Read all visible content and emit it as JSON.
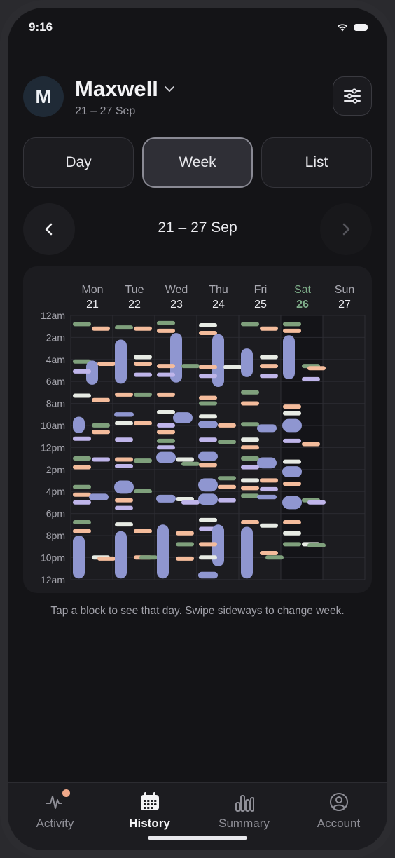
{
  "status": {
    "time": "9:16",
    "wifi_icon": "wifi-icon",
    "battery_icon": "battery-icon"
  },
  "header": {
    "avatar_initial": "M",
    "name": "Maxwell",
    "subtitle": "21 – 27 Sep",
    "dropdown_icon": "chevron-down-icon",
    "filter_icon": "sliders-icon"
  },
  "view_tabs": [
    {
      "label": "Day",
      "active": false
    },
    {
      "label": "Week",
      "active": true
    },
    {
      "label": "List",
      "active": false
    }
  ],
  "week_nav": {
    "title": "21 – 27 Sep",
    "prev_icon": "chevron-left-icon",
    "next_icon": "chevron-right-icon"
  },
  "chart_data": {
    "type": "heatmap",
    "days": [
      {
        "name": "Mon",
        "date": "21",
        "today": false
      },
      {
        "name": "Tue",
        "date": "22",
        "today": false
      },
      {
        "name": "Wed",
        "date": "23",
        "today": false
      },
      {
        "name": "Thu",
        "date": "24",
        "today": false
      },
      {
        "name": "Fri",
        "date": "25",
        "today": false
      },
      {
        "name": "Sat",
        "date": "26",
        "today": true
      },
      {
        "name": "Sun",
        "date": "27",
        "today": false
      }
    ],
    "hour_labels": [
      "12am",
      "2am",
      "4am",
      "6am",
      "8am",
      "10am",
      "12pm",
      "2pm",
      "4pm",
      "6pm",
      "8pm",
      "10pm",
      "12am"
    ],
    "colors": {
      "sleep": "#8f96d0",
      "feed": "#f4bc9c",
      "nappy": "#7fa07c",
      "play": "#e7ebe4",
      "other": "#bfb5ea",
      "today": "#7fae8a"
    },
    "blocks": [
      {
        "day": 0,
        "lane": 0,
        "start": 0.6,
        "end": 1.0,
        "kind": "nappy"
      },
      {
        "day": 0,
        "lane": 1,
        "start": 1.0,
        "end": 1.4,
        "kind": "feed"
      },
      {
        "day": 0,
        "lane": 0,
        "start": 4.0,
        "end": 4.4,
        "kind": "nappy"
      },
      {
        "day": 0,
        "lane": 1,
        "start": 4.1,
        "end": 6.3,
        "kind": "sleep"
      },
      {
        "day": 0,
        "lane": 2,
        "start": 4.2,
        "end": 4.6,
        "kind": "feed"
      },
      {
        "day": 0,
        "lane": 0,
        "start": 4.9,
        "end": 5.3,
        "kind": "other"
      },
      {
        "day": 0,
        "lane": 0,
        "start": 7.1,
        "end": 7.5,
        "kind": "play"
      },
      {
        "day": 0,
        "lane": 1,
        "start": 7.5,
        "end": 7.9,
        "kind": "feed"
      },
      {
        "day": 0,
        "lane": 0,
        "start": 9.2,
        "end": 10.7,
        "kind": "sleep"
      },
      {
        "day": 0,
        "lane": 1,
        "start": 9.8,
        "end": 10.2,
        "kind": "nappy"
      },
      {
        "day": 0,
        "lane": 1,
        "start": 10.4,
        "end": 10.8,
        "kind": "feed"
      },
      {
        "day": 0,
        "lane": 0,
        "start": 11.0,
        "end": 11.4,
        "kind": "other"
      },
      {
        "day": 0,
        "lane": 0,
        "start": 12.8,
        "end": 13.2,
        "kind": "nappy"
      },
      {
        "day": 0,
        "lane": 1,
        "start": 12.9,
        "end": 13.5,
        "kind": "other"
      },
      {
        "day": 0,
        "lane": 0,
        "start": 13.6,
        "end": 14.0,
        "kind": "feed"
      },
      {
        "day": 0,
        "lane": 0,
        "start": 15.4,
        "end": 15.8,
        "kind": "nappy"
      },
      {
        "day": 0,
        "lane": 0,
        "start": 16.1,
        "end": 16.5,
        "kind": "feed"
      },
      {
        "day": 0,
        "lane": 1,
        "start": 16.2,
        "end": 16.8,
        "kind": "sleep"
      },
      {
        "day": 0,
        "lane": 0,
        "start": 16.8,
        "end": 17.2,
        "kind": "other"
      },
      {
        "day": 0,
        "lane": 0,
        "start": 18.6,
        "end": 19.0,
        "kind": "nappy"
      },
      {
        "day": 0,
        "lane": 0,
        "start": 19.4,
        "end": 19.8,
        "kind": "feed"
      },
      {
        "day": 0,
        "lane": 0,
        "start": 20.0,
        "end": 23.9,
        "kind": "sleep"
      },
      {
        "day": 0,
        "lane": 1,
        "start": 21.8,
        "end": 22.2,
        "kind": "play"
      },
      {
        "day": 0,
        "lane": 2,
        "start": 21.9,
        "end": 22.3,
        "kind": "feed"
      },
      {
        "day": 1,
        "lane": 0,
        "start": 0.9,
        "end": 1.3,
        "kind": "nappy"
      },
      {
        "day": 1,
        "lane": 1,
        "start": 1.0,
        "end": 1.4,
        "kind": "feed"
      },
      {
        "day": 1,
        "lane": 0,
        "start": 2.2,
        "end": 6.2,
        "kind": "sleep"
      },
      {
        "day": 1,
        "lane": 1,
        "start": 3.6,
        "end": 4.0,
        "kind": "play"
      },
      {
        "day": 1,
        "lane": 1,
        "start": 4.2,
        "end": 4.6,
        "kind": "feed"
      },
      {
        "day": 1,
        "lane": 1,
        "start": 5.2,
        "end": 5.6,
        "kind": "other"
      },
      {
        "day": 1,
        "lane": 0,
        "start": 7.0,
        "end": 7.4,
        "kind": "feed"
      },
      {
        "day": 1,
        "lane": 1,
        "start": 7.0,
        "end": 7.4,
        "kind": "nappy"
      },
      {
        "day": 1,
        "lane": 0,
        "start": 8.8,
        "end": 9.2,
        "kind": "sleep"
      },
      {
        "day": 1,
        "lane": 0,
        "start": 9.6,
        "end": 10.0,
        "kind": "play"
      },
      {
        "day": 1,
        "lane": 1,
        "start": 9.6,
        "end": 10.0,
        "kind": "feed"
      },
      {
        "day": 1,
        "lane": 0,
        "start": 11.1,
        "end": 11.5,
        "kind": "other"
      },
      {
        "day": 1,
        "lane": 0,
        "start": 12.9,
        "end": 13.3,
        "kind": "feed"
      },
      {
        "day": 1,
        "lane": 1,
        "start": 13.0,
        "end": 13.4,
        "kind": "nappy"
      },
      {
        "day": 1,
        "lane": 0,
        "start": 13.5,
        "end": 13.9,
        "kind": "other"
      },
      {
        "day": 1,
        "lane": 0,
        "start": 15.0,
        "end": 16.2,
        "kind": "sleep"
      },
      {
        "day": 1,
        "lane": 1,
        "start": 15.8,
        "end": 16.2,
        "kind": "nappy"
      },
      {
        "day": 1,
        "lane": 0,
        "start": 16.6,
        "end": 17.0,
        "kind": "feed"
      },
      {
        "day": 1,
        "lane": 0,
        "start": 17.3,
        "end": 17.7,
        "kind": "other"
      },
      {
        "day": 1,
        "lane": 0,
        "start": 18.8,
        "end": 19.2,
        "kind": "play"
      },
      {
        "day": 1,
        "lane": 1,
        "start": 19.4,
        "end": 19.8,
        "kind": "feed"
      },
      {
        "day": 1,
        "lane": 0,
        "start": 19.6,
        "end": 23.9,
        "kind": "sleep"
      },
      {
        "day": 1,
        "lane": 1,
        "start": 21.8,
        "end": 22.2,
        "kind": "feed"
      },
      {
        "day": 1,
        "lane": 2,
        "start": 21.8,
        "end": 22.2,
        "kind": "nappy"
      },
      {
        "day": 2,
        "lane": 0,
        "start": 0.5,
        "end": 0.9,
        "kind": "nappy"
      },
      {
        "day": 2,
        "lane": 0,
        "start": 1.2,
        "end": 1.6,
        "kind": "feed"
      },
      {
        "day": 2,
        "lane": 1,
        "start": 1.6,
        "end": 6.1,
        "kind": "sleep"
      },
      {
        "day": 2,
        "lane": 0,
        "start": 4.4,
        "end": 4.8,
        "kind": "feed"
      },
      {
        "day": 2,
        "lane": 2,
        "start": 4.4,
        "end": 4.8,
        "kind": "nappy"
      },
      {
        "day": 2,
        "lane": 0,
        "start": 5.2,
        "end": 5.6,
        "kind": "other"
      },
      {
        "day": 2,
        "lane": 0,
        "start": 7.0,
        "end": 7.4,
        "kind": "feed"
      },
      {
        "day": 2,
        "lane": 0,
        "start": 8.6,
        "end": 9.0,
        "kind": "play"
      },
      {
        "day": 2,
        "lane": 1,
        "start": 8.8,
        "end": 9.8,
        "kind": "sleep"
      },
      {
        "day": 2,
        "lane": 0,
        "start": 9.8,
        "end": 10.2,
        "kind": "other"
      },
      {
        "day": 2,
        "lane": 0,
        "start": 10.4,
        "end": 10.8,
        "kind": "feed"
      },
      {
        "day": 2,
        "lane": 0,
        "start": 11.2,
        "end": 11.6,
        "kind": "nappy"
      },
      {
        "day": 2,
        "lane": 0,
        "start": 11.8,
        "end": 12.2,
        "kind": "other"
      },
      {
        "day": 2,
        "lane": 0,
        "start": 12.4,
        "end": 13.4,
        "kind": "sleep"
      },
      {
        "day": 2,
        "lane": 1,
        "start": 12.9,
        "end": 13.3,
        "kind": "play"
      },
      {
        "day": 2,
        "lane": 2,
        "start": 13.3,
        "end": 13.7,
        "kind": "nappy"
      },
      {
        "day": 2,
        "lane": 0,
        "start": 16.3,
        "end": 17.0,
        "kind": "sleep"
      },
      {
        "day": 2,
        "lane": 1,
        "start": 16.5,
        "end": 17.0,
        "kind": "play"
      },
      {
        "day": 2,
        "lane": 2,
        "start": 16.8,
        "end": 17.2,
        "kind": "other"
      },
      {
        "day": 2,
        "lane": 0,
        "start": 19.0,
        "end": 23.9,
        "kind": "sleep"
      },
      {
        "day": 2,
        "lane": 1,
        "start": 19.6,
        "end": 20.0,
        "kind": "feed"
      },
      {
        "day": 2,
        "lane": 1,
        "start": 20.6,
        "end": 21.0,
        "kind": "nappy"
      },
      {
        "day": 2,
        "lane": 1,
        "start": 21.9,
        "end": 22.3,
        "kind": "feed"
      },
      {
        "day": 3,
        "lane": 0,
        "start": 0.7,
        "end": 1.1,
        "kind": "play"
      },
      {
        "day": 3,
        "lane": 0,
        "start": 1.4,
        "end": 1.8,
        "kind": "feed"
      },
      {
        "day": 3,
        "lane": 1,
        "start": 1.7,
        "end": 6.5,
        "kind": "sleep"
      },
      {
        "day": 3,
        "lane": 0,
        "start": 4.5,
        "end": 4.9,
        "kind": "feed"
      },
      {
        "day": 3,
        "lane": 2,
        "start": 4.5,
        "end": 4.9,
        "kind": "play"
      },
      {
        "day": 3,
        "lane": 0,
        "start": 5.3,
        "end": 5.7,
        "kind": "other"
      },
      {
        "day": 3,
        "lane": 0,
        "start": 7.3,
        "end": 7.7,
        "kind": "feed"
      },
      {
        "day": 3,
        "lane": 0,
        "start": 7.8,
        "end": 8.2,
        "kind": "nappy"
      },
      {
        "day": 3,
        "lane": 0,
        "start": 9.0,
        "end": 9.4,
        "kind": "play"
      },
      {
        "day": 3,
        "lane": 0,
        "start": 9.6,
        "end": 10.2,
        "kind": "sleep"
      },
      {
        "day": 3,
        "lane": 1,
        "start": 9.8,
        "end": 10.2,
        "kind": "feed"
      },
      {
        "day": 3,
        "lane": 0,
        "start": 11.1,
        "end": 11.5,
        "kind": "other"
      },
      {
        "day": 3,
        "lane": 1,
        "start": 11.3,
        "end": 11.7,
        "kind": "nappy"
      },
      {
        "day": 3,
        "lane": 0,
        "start": 12.4,
        "end": 13.2,
        "kind": "sleep"
      },
      {
        "day": 3,
        "lane": 0,
        "start": 13.4,
        "end": 13.8,
        "kind": "feed"
      },
      {
        "day": 3,
        "lane": 0,
        "start": 14.8,
        "end": 16.0,
        "kind": "sleep"
      },
      {
        "day": 3,
        "lane": 1,
        "start": 14.6,
        "end": 15.0,
        "kind": "nappy"
      },
      {
        "day": 3,
        "lane": 1,
        "start": 15.4,
        "end": 15.8,
        "kind": "feed"
      },
      {
        "day": 3,
        "lane": 0,
        "start": 16.2,
        "end": 17.2,
        "kind": "sleep"
      },
      {
        "day": 3,
        "lane": 1,
        "start": 16.6,
        "end": 17.0,
        "kind": "other"
      },
      {
        "day": 3,
        "lane": 0,
        "start": 18.4,
        "end": 18.8,
        "kind": "play"
      },
      {
        "day": 3,
        "lane": 0,
        "start": 19.2,
        "end": 19.6,
        "kind": "other"
      },
      {
        "day": 3,
        "lane": 1,
        "start": 19.0,
        "end": 22.8,
        "kind": "sleep"
      },
      {
        "day": 3,
        "lane": 0,
        "start": 20.6,
        "end": 21.0,
        "kind": "feed"
      },
      {
        "day": 3,
        "lane": 0,
        "start": 21.8,
        "end": 22.2,
        "kind": "play"
      },
      {
        "day": 3,
        "lane": 0,
        "start": 23.3,
        "end": 23.9,
        "kind": "sleep"
      },
      {
        "day": 4,
        "lane": 0,
        "start": 0.6,
        "end": 1.0,
        "kind": "nappy"
      },
      {
        "day": 4,
        "lane": 1,
        "start": 1.0,
        "end": 1.4,
        "kind": "feed"
      },
      {
        "day": 4,
        "lane": 0,
        "start": 3.0,
        "end": 5.6,
        "kind": "sleep"
      },
      {
        "day": 4,
        "lane": 1,
        "start": 3.6,
        "end": 4.0,
        "kind": "play"
      },
      {
        "day": 4,
        "lane": 1,
        "start": 4.4,
        "end": 4.8,
        "kind": "feed"
      },
      {
        "day": 4,
        "lane": 1,
        "start": 5.3,
        "end": 5.7,
        "kind": "other"
      },
      {
        "day": 4,
        "lane": 0,
        "start": 6.8,
        "end": 7.2,
        "kind": "nappy"
      },
      {
        "day": 4,
        "lane": 0,
        "start": 7.8,
        "end": 8.2,
        "kind": "feed"
      },
      {
        "day": 4,
        "lane": 0,
        "start": 9.7,
        "end": 10.1,
        "kind": "nappy"
      },
      {
        "day": 4,
        "lane": 1,
        "start": 9.9,
        "end": 10.6,
        "kind": "sleep"
      },
      {
        "day": 4,
        "lane": 0,
        "start": 11.1,
        "end": 11.5,
        "kind": "play"
      },
      {
        "day": 4,
        "lane": 0,
        "start": 11.8,
        "end": 12.2,
        "kind": "feed"
      },
      {
        "day": 4,
        "lane": 0,
        "start": 12.8,
        "end": 13.2,
        "kind": "nappy"
      },
      {
        "day": 4,
        "lane": 1,
        "start": 12.9,
        "end": 13.9,
        "kind": "sleep"
      },
      {
        "day": 4,
        "lane": 0,
        "start": 13.6,
        "end": 14.0,
        "kind": "other"
      },
      {
        "day": 4,
        "lane": 0,
        "start": 14.8,
        "end": 15.2,
        "kind": "play"
      },
      {
        "day": 4,
        "lane": 1,
        "start": 14.8,
        "end": 15.2,
        "kind": "feed"
      },
      {
        "day": 4,
        "lane": 0,
        "start": 15.5,
        "end": 15.9,
        "kind": "feed"
      },
      {
        "day": 4,
        "lane": 1,
        "start": 15.6,
        "end": 16.0,
        "kind": "other"
      },
      {
        "day": 4,
        "lane": 0,
        "start": 16.2,
        "end": 16.6,
        "kind": "nappy"
      },
      {
        "day": 4,
        "lane": 1,
        "start": 16.3,
        "end": 16.7,
        "kind": "sleep"
      },
      {
        "day": 4,
        "lane": 0,
        "start": 18.6,
        "end": 19.0,
        "kind": "feed"
      },
      {
        "day": 4,
        "lane": 1,
        "start": 18.9,
        "end": 19.3,
        "kind": "play"
      },
      {
        "day": 4,
        "lane": 0,
        "start": 19.2,
        "end": 23.9,
        "kind": "sleep"
      },
      {
        "day": 4,
        "lane": 1,
        "start": 21.4,
        "end": 21.8,
        "kind": "feed"
      },
      {
        "day": 4,
        "lane": 2,
        "start": 21.8,
        "end": 22.2,
        "kind": "nappy"
      },
      {
        "day": 5,
        "lane": 0,
        "start": 0.6,
        "end": 1.0,
        "kind": "nappy"
      },
      {
        "day": 5,
        "lane": 0,
        "start": 1.2,
        "end": 1.6,
        "kind": "feed"
      },
      {
        "day": 5,
        "lane": 0,
        "start": 1.8,
        "end": 5.8,
        "kind": "sleep"
      },
      {
        "day": 5,
        "lane": 1,
        "start": 4.4,
        "end": 4.8,
        "kind": "nappy"
      },
      {
        "day": 5,
        "lane": 2,
        "start": 4.6,
        "end": 5.0,
        "kind": "feed"
      },
      {
        "day": 5,
        "lane": 1,
        "start": 5.6,
        "end": 6.0,
        "kind": "other"
      },
      {
        "day": 5,
        "lane": 0,
        "start": 8.1,
        "end": 8.5,
        "kind": "feed"
      },
      {
        "day": 5,
        "lane": 0,
        "start": 8.7,
        "end": 9.1,
        "kind": "play"
      },
      {
        "day": 5,
        "lane": 0,
        "start": 9.4,
        "end": 10.6,
        "kind": "sleep"
      },
      {
        "day": 5,
        "lane": 0,
        "start": 11.2,
        "end": 11.6,
        "kind": "other"
      },
      {
        "day": 5,
        "lane": 1,
        "start": 11.5,
        "end": 11.9,
        "kind": "feed"
      },
      {
        "day": 5,
        "lane": 0,
        "start": 13.1,
        "end": 13.5,
        "kind": "play"
      },
      {
        "day": 5,
        "lane": 0,
        "start": 13.7,
        "end": 14.7,
        "kind": "sleep"
      },
      {
        "day": 5,
        "lane": 0,
        "start": 15.1,
        "end": 15.5,
        "kind": "feed"
      },
      {
        "day": 5,
        "lane": 0,
        "start": 16.4,
        "end": 17.6,
        "kind": "sleep"
      },
      {
        "day": 5,
        "lane": 1,
        "start": 16.6,
        "end": 17.0,
        "kind": "nappy"
      },
      {
        "day": 5,
        "lane": 2,
        "start": 16.8,
        "end": 17.2,
        "kind": "other"
      },
      {
        "day": 5,
        "lane": 0,
        "start": 18.6,
        "end": 19.0,
        "kind": "feed"
      },
      {
        "day": 5,
        "lane": 0,
        "start": 19.6,
        "end": 20.0,
        "kind": "play"
      },
      {
        "day": 5,
        "lane": 0,
        "start": 20.6,
        "end": 21.2,
        "kind": "nappy"
      },
      {
        "day": 5,
        "lane": 1,
        "start": 20.6,
        "end": 21.0,
        "kind": "play"
      },
      {
        "day": 5,
        "lane": 2,
        "start": 20.7,
        "end": 21.1,
        "kind": "nappy"
      }
    ]
  },
  "hint": "Tap a block to see that day. Swipe sideways to change week.",
  "tabbar": [
    {
      "label": "Activity",
      "icon": "activity-icon",
      "active": false,
      "badge": true
    },
    {
      "label": "History",
      "icon": "calendar-icon",
      "active": true,
      "badge": false
    },
    {
      "label": "Summary",
      "icon": "bar-chart-icon",
      "active": false,
      "badge": false
    },
    {
      "label": "Account",
      "icon": "account-icon",
      "active": false,
      "badge": false
    }
  ]
}
